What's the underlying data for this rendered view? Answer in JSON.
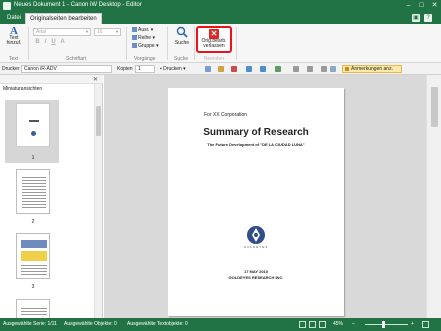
{
  "window": {
    "title": "Neues Dokument 1 - Canon iW Desktop - Editor",
    "controls": [
      "–",
      "□",
      "✕"
    ]
  },
  "tabs": {
    "file": "Datei",
    "active": "Originalseiten bearbeiten"
  },
  "ribbon": {
    "text_group": {
      "button_label": "Text\nhinzuf.",
      "group_label": "Text"
    },
    "font_group": {
      "font_value": "Arial",
      "size_value": "10",
      "group_label": "Schriftart",
      "bold": "B",
      "italic": "I",
      "underline": "U",
      "strike": "A"
    },
    "arrange_group": {
      "items": [
        "Ausr.",
        "Reihe",
        "Gruppe"
      ],
      "group_label": "Vorgänge"
    },
    "search_group": {
      "button_label": "Suche",
      "group_label": "Suche"
    },
    "exit_group": {
      "button_label": "Orig.bearb.\nverlassen",
      "group_label": "Beenden"
    }
  },
  "quickbar": {
    "printer_label": "Drucker",
    "printer_value": "Canon iR-ADV",
    "copies_label": "Kopien",
    "copies_value": "1",
    "print_button": "Drucken",
    "annotations_button": "Anmerkungen anz."
  },
  "thumbnails": {
    "pane_label": "Miniaturansichten",
    "pages": [
      "1",
      "2",
      "3"
    ]
  },
  "document": {
    "for_line": "For XX Corporation",
    "title": "Summary of Research",
    "subtitle": "The Future Development of \"DE LA CIUDAD LUNA\"",
    "logo_text": "GOLDEYES",
    "date": "17 MAY 2010",
    "company": "GOLDEYES RESEARCH INC."
  },
  "statusbar": {
    "selected_series": "Ausgewählte Serie: 1/11",
    "selected_objects": "Ausgewählte Objekte: 0",
    "selected_textobjects": "Ausgewählte Textobjekte: 0",
    "zoom": "45%"
  },
  "colors": {
    "brand": "#217346",
    "highlight": "#e8141b",
    "annotation": "#fde9a8"
  }
}
